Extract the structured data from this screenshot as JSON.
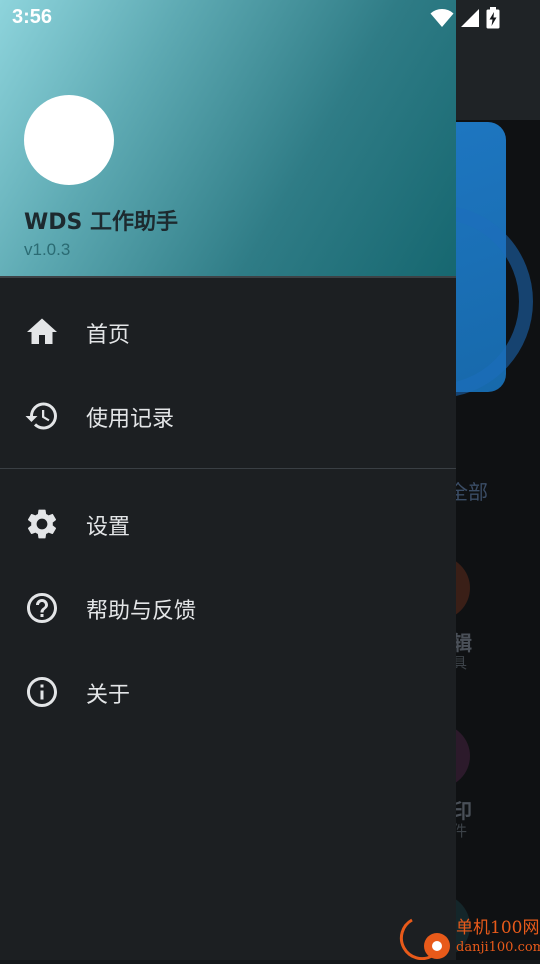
{
  "status_bar": {
    "time": "3:56"
  },
  "drawer": {
    "header": {
      "app_name": "WDS 工作助手",
      "version": "v1.0.3"
    },
    "menu": {
      "home": {
        "label": "首页",
        "icon": "home-icon"
      },
      "history": {
        "label": "使用记录",
        "icon": "history-icon"
      },
      "settings": {
        "label": "设置",
        "icon": "gear-icon"
      },
      "help": {
        "label": "帮助与反馈",
        "icon": "help-circle-icon"
      },
      "about": {
        "label": "关于",
        "icon": "info-circle-icon"
      }
    }
  },
  "background": {
    "view_all": "全部",
    "edit_fragment": "辑",
    "edit_sub_fragment": "具",
    "print_fragment": "印",
    "print_sub_fragment": "件"
  },
  "watermark": {
    "brand": "单机100网",
    "domain": "danji100.com"
  },
  "colors": {
    "header_gradient_start": "#8ed4dc",
    "header_gradient_end": "#166770",
    "drawer_background": "#1c1f22",
    "text_primary": "#e3e5e7",
    "watermark": "#e85a1a"
  }
}
